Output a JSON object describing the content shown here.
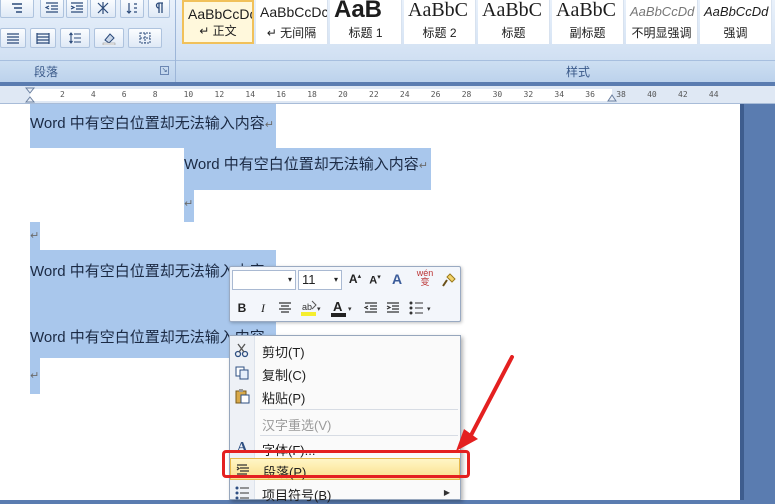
{
  "ribbon": {
    "groups": {
      "paragraph": "段落",
      "styles": "样式"
    },
    "styles": [
      {
        "preview": "AaBbCcDc",
        "name": "↵ 正文"
      },
      {
        "preview": "AaBbCcDc",
        "name": "↵ 无间隔"
      },
      {
        "preview": "AaB",
        "name": "标题 1"
      },
      {
        "preview": "AaBbC",
        "name": "标题 2"
      },
      {
        "preview": "AaBbC",
        "name": "标题"
      },
      {
        "preview": "AaBbC",
        "name": "副标题"
      },
      {
        "preview": "AaBbCcDd",
        "name": "不明显强调"
      },
      {
        "preview": "AaBbCcDd",
        "name": "强调"
      }
    ]
  },
  "ruler": {
    "ticks": [
      "2",
      "4",
      "6",
      "8",
      "10",
      "12",
      "14",
      "16",
      "18",
      "20",
      "22",
      "24",
      "26",
      "28",
      "30",
      "32",
      "34",
      "36",
      "38",
      "40",
      "42",
      "44"
    ]
  },
  "document": {
    "lines": [
      "Word 中有空白位置却无法输入内容",
      "Word 中有空白位置却无法输入内容",
      "Word 中有空白位置却无法输入内容",
      "Word 中有空白位置却无法输入内容"
    ],
    "paragraph_mark": "↵"
  },
  "mini_toolbar": {
    "font_name": "",
    "font_size": "11",
    "row1_icons": [
      "grow-font",
      "shrink-font",
      "clear-format",
      "phonetic",
      "format-painter"
    ],
    "row2_icons": [
      "bold",
      "italic",
      "center",
      "highlight",
      "font-color",
      "decrease-indent",
      "increase-indent",
      "bullets"
    ],
    "bold": "B",
    "italic": "I",
    "phonetic": "wén\n变"
  },
  "context_menu": {
    "items": [
      {
        "label": "剪切(T)",
        "icon": "scissors-icon",
        "enabled": true
      },
      {
        "label": "复制(C)",
        "icon": "copy-icon",
        "enabled": true
      },
      {
        "label": "粘贴(P)",
        "icon": "paste-icon",
        "enabled": true
      },
      {
        "label": "汉字重选(V)",
        "icon": "",
        "enabled": false
      },
      {
        "label": "字体(F)...",
        "icon": "font-icon",
        "enabled": true
      },
      {
        "label": "段落(P)...",
        "icon": "paragraph-icon",
        "enabled": true,
        "highlighted": true
      },
      {
        "label": "项目符号(B)",
        "icon": "bullets-icon",
        "enabled": true,
        "submenu": true
      }
    ]
  },
  "colors": {
    "selection": "#a9c7ec",
    "highlight_annotation": "#e42020",
    "ribbon": "#d5e3f4"
  }
}
